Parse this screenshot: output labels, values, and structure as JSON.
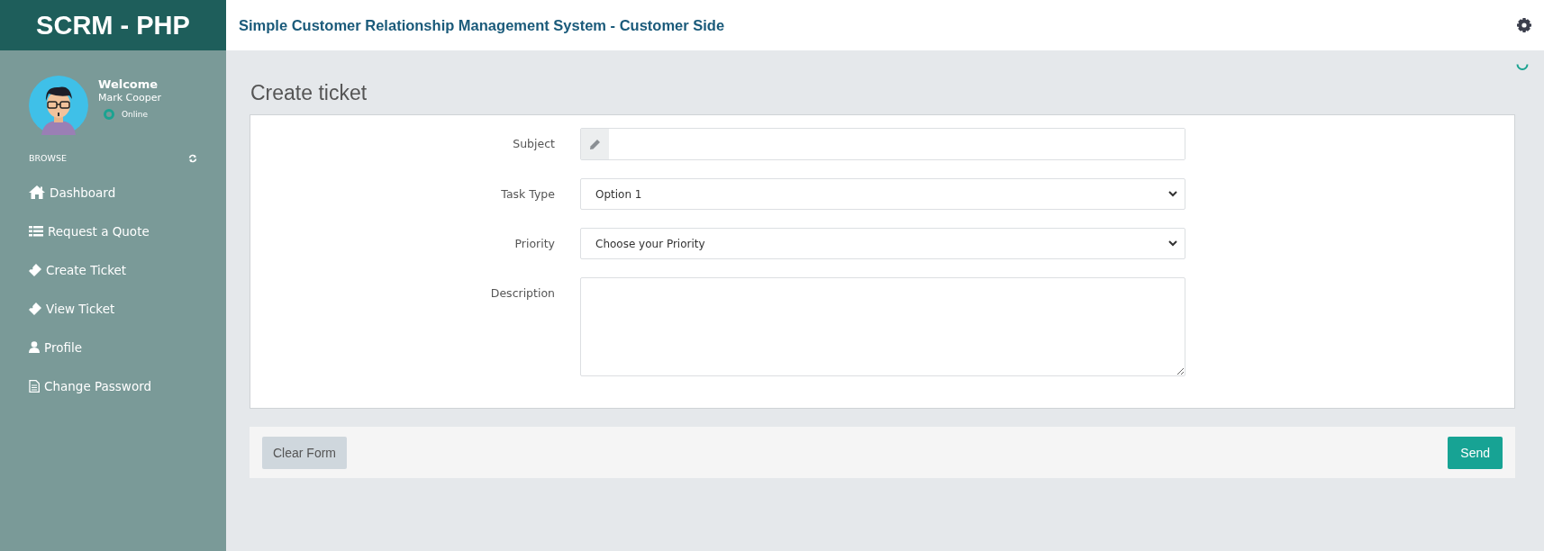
{
  "brand": "SCRM - PHP",
  "header": {
    "title": "Simple Customer Relationship Management System - Customer Side"
  },
  "user": {
    "greeting": "Welcome",
    "name": "Mark Cooper",
    "status": "Online"
  },
  "sidebar": {
    "section": "BROWSE",
    "items": [
      {
        "label": "Dashboard"
      },
      {
        "label": "Request a Quote"
      },
      {
        "label": "Create Ticket"
      },
      {
        "label": "View Ticket"
      },
      {
        "label": "Profile"
      },
      {
        "label": "Change Password"
      }
    ]
  },
  "page": {
    "title": "Create ticket"
  },
  "form": {
    "fields": [
      {
        "kind": "text",
        "label": "Subject"
      },
      {
        "kind": "select",
        "label": "Task Type",
        "value": "Option 1"
      },
      {
        "kind": "select",
        "label": "Priority",
        "value": "Choose your Priority"
      },
      {
        "kind": "textarea",
        "label": "Description"
      }
    ],
    "buttons": [
      {
        "kind": "secondary",
        "label": "Clear Form"
      },
      {
        "kind": "primary",
        "label": "Send"
      }
    ]
  }
}
